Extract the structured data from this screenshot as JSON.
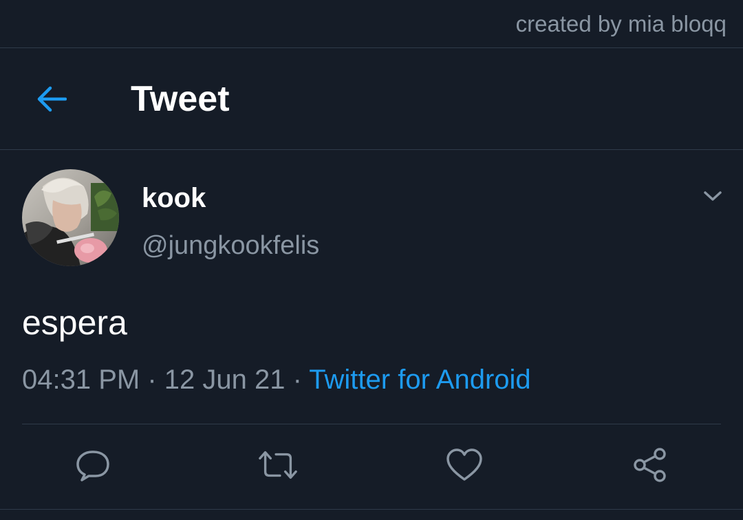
{
  "watermark": "created by mia bloqq",
  "header": {
    "title": "Tweet",
    "back_icon": "arrow-left-icon",
    "accent_color": "#1d9bf0"
  },
  "tweet": {
    "author": {
      "display_name": "kook",
      "handle": "@jungkookfelis",
      "avatar": "profile-photo"
    },
    "text": "espera",
    "time": "04:31 PM",
    "separator": " · ",
    "date": "12 Jun 21",
    "source": "Twitter for Android"
  },
  "actions": [
    {
      "icon": "reply-icon"
    },
    {
      "icon": "retweet-icon"
    },
    {
      "icon": "like-icon"
    },
    {
      "icon": "share-icon"
    }
  ],
  "colors": {
    "background": "#151c27",
    "secondary_text": "#8a96a3",
    "divider": "#2f3b4a",
    "link": "#1d9bf0"
  }
}
